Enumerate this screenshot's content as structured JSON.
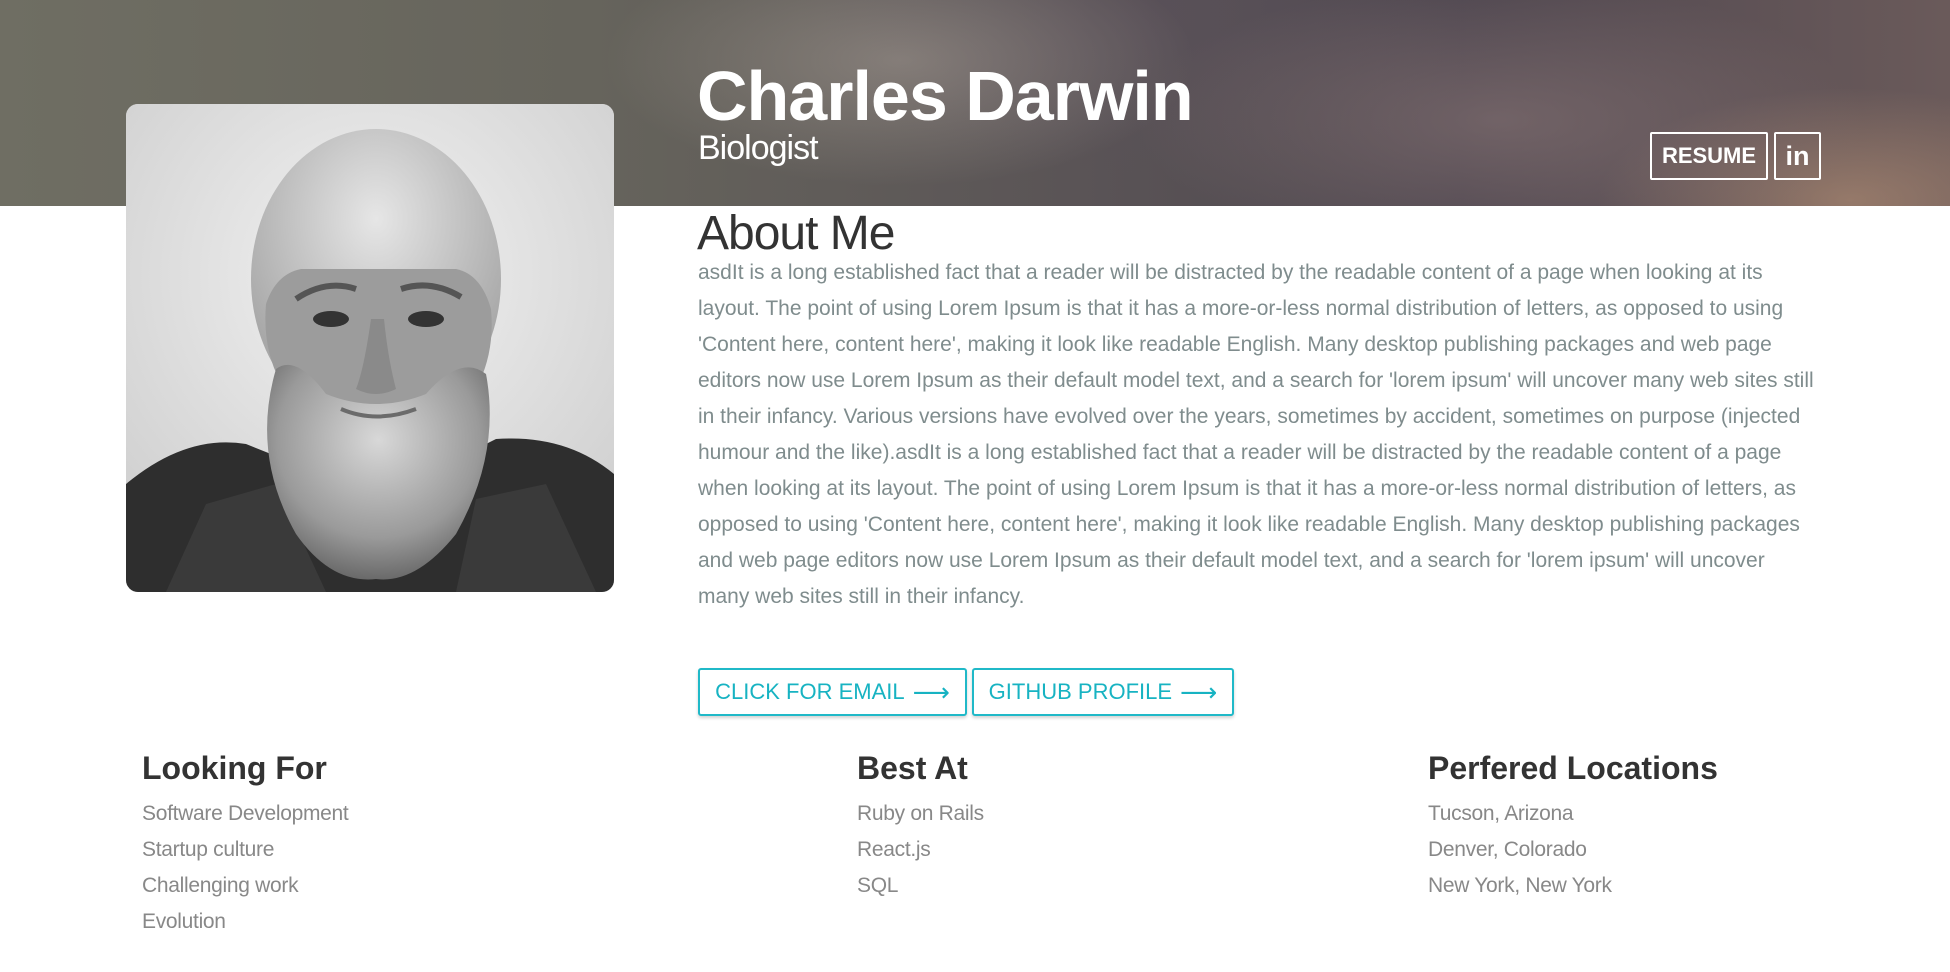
{
  "header": {
    "name": "Charles Darwin",
    "role": "Biologist",
    "resume_label": "RESUME",
    "linkedin_label": "in"
  },
  "portrait": {
    "icon": "portrait-photo"
  },
  "about": {
    "title": "About Me",
    "body": "asdIt is a long established fact that a reader will be distracted by the readable content of a page when looking at its layout. The point of using Lorem Ipsum is that it has a more-or-less normal distribution of letters, as opposed to using 'Content here, content here', making it look like readable English. Many desktop publishing packages and web page editors now use Lorem Ipsum as their default model text, and a search for 'lorem ipsum' will uncover many web sites still in their infancy. Various versions have evolved over the years, sometimes by accident, sometimes on purpose (injected humour and the like).asdIt is a long established fact that a reader will be distracted by the readable content of a page when looking at its layout. The point of using Lorem Ipsum is that it has a more-or-less normal distribution of letters, as opposed to using 'Content here, content here', making it look like readable English. Many desktop publishing packages and web page editors now use Lorem Ipsum as their default model text, and a search for 'lorem ipsum' will uncover many web sites still in their infancy."
  },
  "actions": {
    "email_label": "CLICK FOR EMAIL",
    "github_label": "GITHUB PROFILE",
    "arrow_icon": "arrow-right-icon",
    "accent_color": "#20b9c8"
  },
  "sections": {
    "looking_for": {
      "title": "Looking For",
      "items": [
        "Software Development",
        "Startup culture",
        "Challenging work",
        "Evolution"
      ]
    },
    "best_at": {
      "title": "Best At",
      "items": [
        "Ruby on Rails",
        "React.js",
        "SQL"
      ]
    },
    "locations": {
      "title": "Perfered Locations",
      "items": [
        "Tucson, Arizona",
        "Denver, Colorado",
        "New York, New York"
      ]
    }
  }
}
